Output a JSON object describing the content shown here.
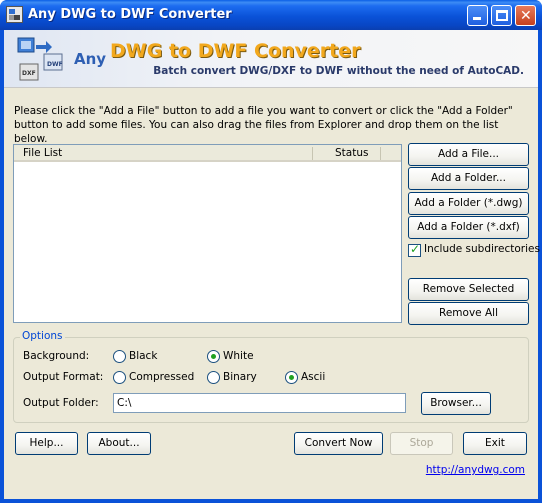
{
  "window": {
    "title": "Any DWG to DWF Converter"
  },
  "banner": {
    "any": "Any",
    "title": "DWG to DWF Converter",
    "subtitle": "Batch convert DWG/DXF to DWF without the need of AutoCAD."
  },
  "instructions": "Please click the \"Add a File\" button to add a file you want to convert or click the \"Add a Folder\" button to add some files. You can also drag the files from Explorer and drop them on the list below.",
  "file_list": {
    "columns": [
      "File List",
      "Status"
    ],
    "rows": []
  },
  "buttons": {
    "add_file": "Add a File...",
    "add_folder": "Add a Folder...",
    "add_folder_dwg": "Add a Folder (*.dwg)",
    "add_folder_dxf": "Add a Folder (*.dxf)",
    "remove_selected": "Remove Selected",
    "remove_all": "Remove All",
    "browser": "Browser...",
    "help": "Help...",
    "about": "About...",
    "convert_now": "Convert Now",
    "stop": "Stop",
    "exit": "Exit"
  },
  "include_subdirectories": {
    "label": "Include subdirectories",
    "checked": true
  },
  "options": {
    "legend": "Options",
    "background": {
      "label": "Background:",
      "choices": [
        "Black",
        "White"
      ],
      "selected": "White"
    },
    "output_format": {
      "label": "Output Format:",
      "choices": [
        "Compressed",
        "Binary",
        "Ascii"
      ],
      "selected": "Ascii"
    },
    "output_folder": {
      "label": "Output Folder:",
      "value": "C:\\"
    }
  },
  "link": "http://anydwg.com",
  "colors": {
    "title_bar": "#0a52d8",
    "client_bg": "#ece9d8",
    "banner_title": "#f2a81d",
    "legend_text": "#0046d5",
    "link": "#0000ee"
  }
}
